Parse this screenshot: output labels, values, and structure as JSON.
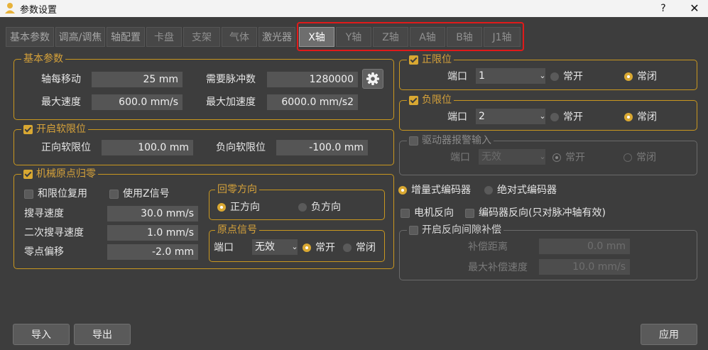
{
  "window": {
    "title": "参数设置",
    "help_label": "?",
    "close_label": "✕",
    "icon": "user-icon"
  },
  "tabs": [
    {
      "label": "基本参数"
    },
    {
      "label": "调高/调焦"
    },
    {
      "label": "轴配置"
    },
    {
      "label": "卡盘"
    },
    {
      "label": "支架"
    },
    {
      "label": "气体"
    },
    {
      "label": "激光器"
    },
    {
      "label": "X轴",
      "active": true
    },
    {
      "label": "Y轴"
    },
    {
      "label": "Z轴"
    },
    {
      "label": "A轴"
    },
    {
      "label": "B轴"
    },
    {
      "label": "J1轴"
    }
  ],
  "basic": {
    "title": "基本参数",
    "move_per_rev_label": "轴每移动",
    "move_per_rev_value": "25 mm",
    "pulses_label": "需要脉冲数",
    "pulses_value": "1280000",
    "max_speed_label": "最大速度",
    "max_speed_value": "600.0 mm/s",
    "max_accel_label": "最大加速度",
    "max_accel_value": "6000.0 mm/s2"
  },
  "soft_limit": {
    "title": "开启软限位",
    "checked": true,
    "positive_label": "正向软限位",
    "positive_value": "100.0 mm",
    "negative_label": "负向软限位",
    "negative_value": "-100.0 mm"
  },
  "homing": {
    "title": "机械原点归零",
    "checked": true,
    "reuse_limit_label": "和限位复用",
    "use_z_label": "使用Z信号",
    "search_speed_label": "搜寻速度",
    "search_speed_value": "30.0 mm/s",
    "second_speed_label": "二次搜寻速度",
    "second_speed_value": "1.0 mm/s",
    "offset_label": "零点偏移",
    "offset_value": "-2.0 mm",
    "direction": {
      "title": "回零方向",
      "positive_label": "正方向",
      "negative_label": "负方向",
      "selected": "positive"
    },
    "origin_signal": {
      "title": "原点信号",
      "port_label": "端口",
      "port_value": "无效",
      "no_label": "常开",
      "nc_label": "常闭",
      "selected": "no"
    }
  },
  "pos_limit": {
    "title": "正限位",
    "checked": true,
    "port_label": "端口",
    "port_value": "1",
    "no_label": "常开",
    "nc_label": "常闭",
    "selected": "nc"
  },
  "neg_limit": {
    "title": "负限位",
    "checked": true,
    "port_label": "端口",
    "port_value": "2",
    "no_label": "常开",
    "nc_label": "常闭",
    "selected": "nc"
  },
  "alarm": {
    "title": "驱动器报警输入",
    "checked": false,
    "port_label": "端口",
    "port_value": "无效",
    "no_label": "常开",
    "nc_label": "常闭",
    "selected": "no"
  },
  "encoder": {
    "incremental_label": "增量式编码器",
    "absolute_label": "绝对式编码器",
    "selected": "incremental",
    "motor_reverse_label": "电机反向",
    "encoder_reverse_label": "编码器反向(只对脉冲轴有效)"
  },
  "backlash": {
    "title": "开启反向间隙补偿",
    "checked": false,
    "distance_label": "补偿距离",
    "distance_value": "0.0 mm",
    "max_speed_label": "最大补偿速度",
    "max_speed_value": "10.0 mm/s"
  },
  "footer": {
    "import_label": "导入",
    "export_label": "导出",
    "apply_label": "应用"
  },
  "colors": {
    "accent": "#d9a832",
    "background": "#3d3d3d",
    "highlight": "#e01a1a"
  }
}
